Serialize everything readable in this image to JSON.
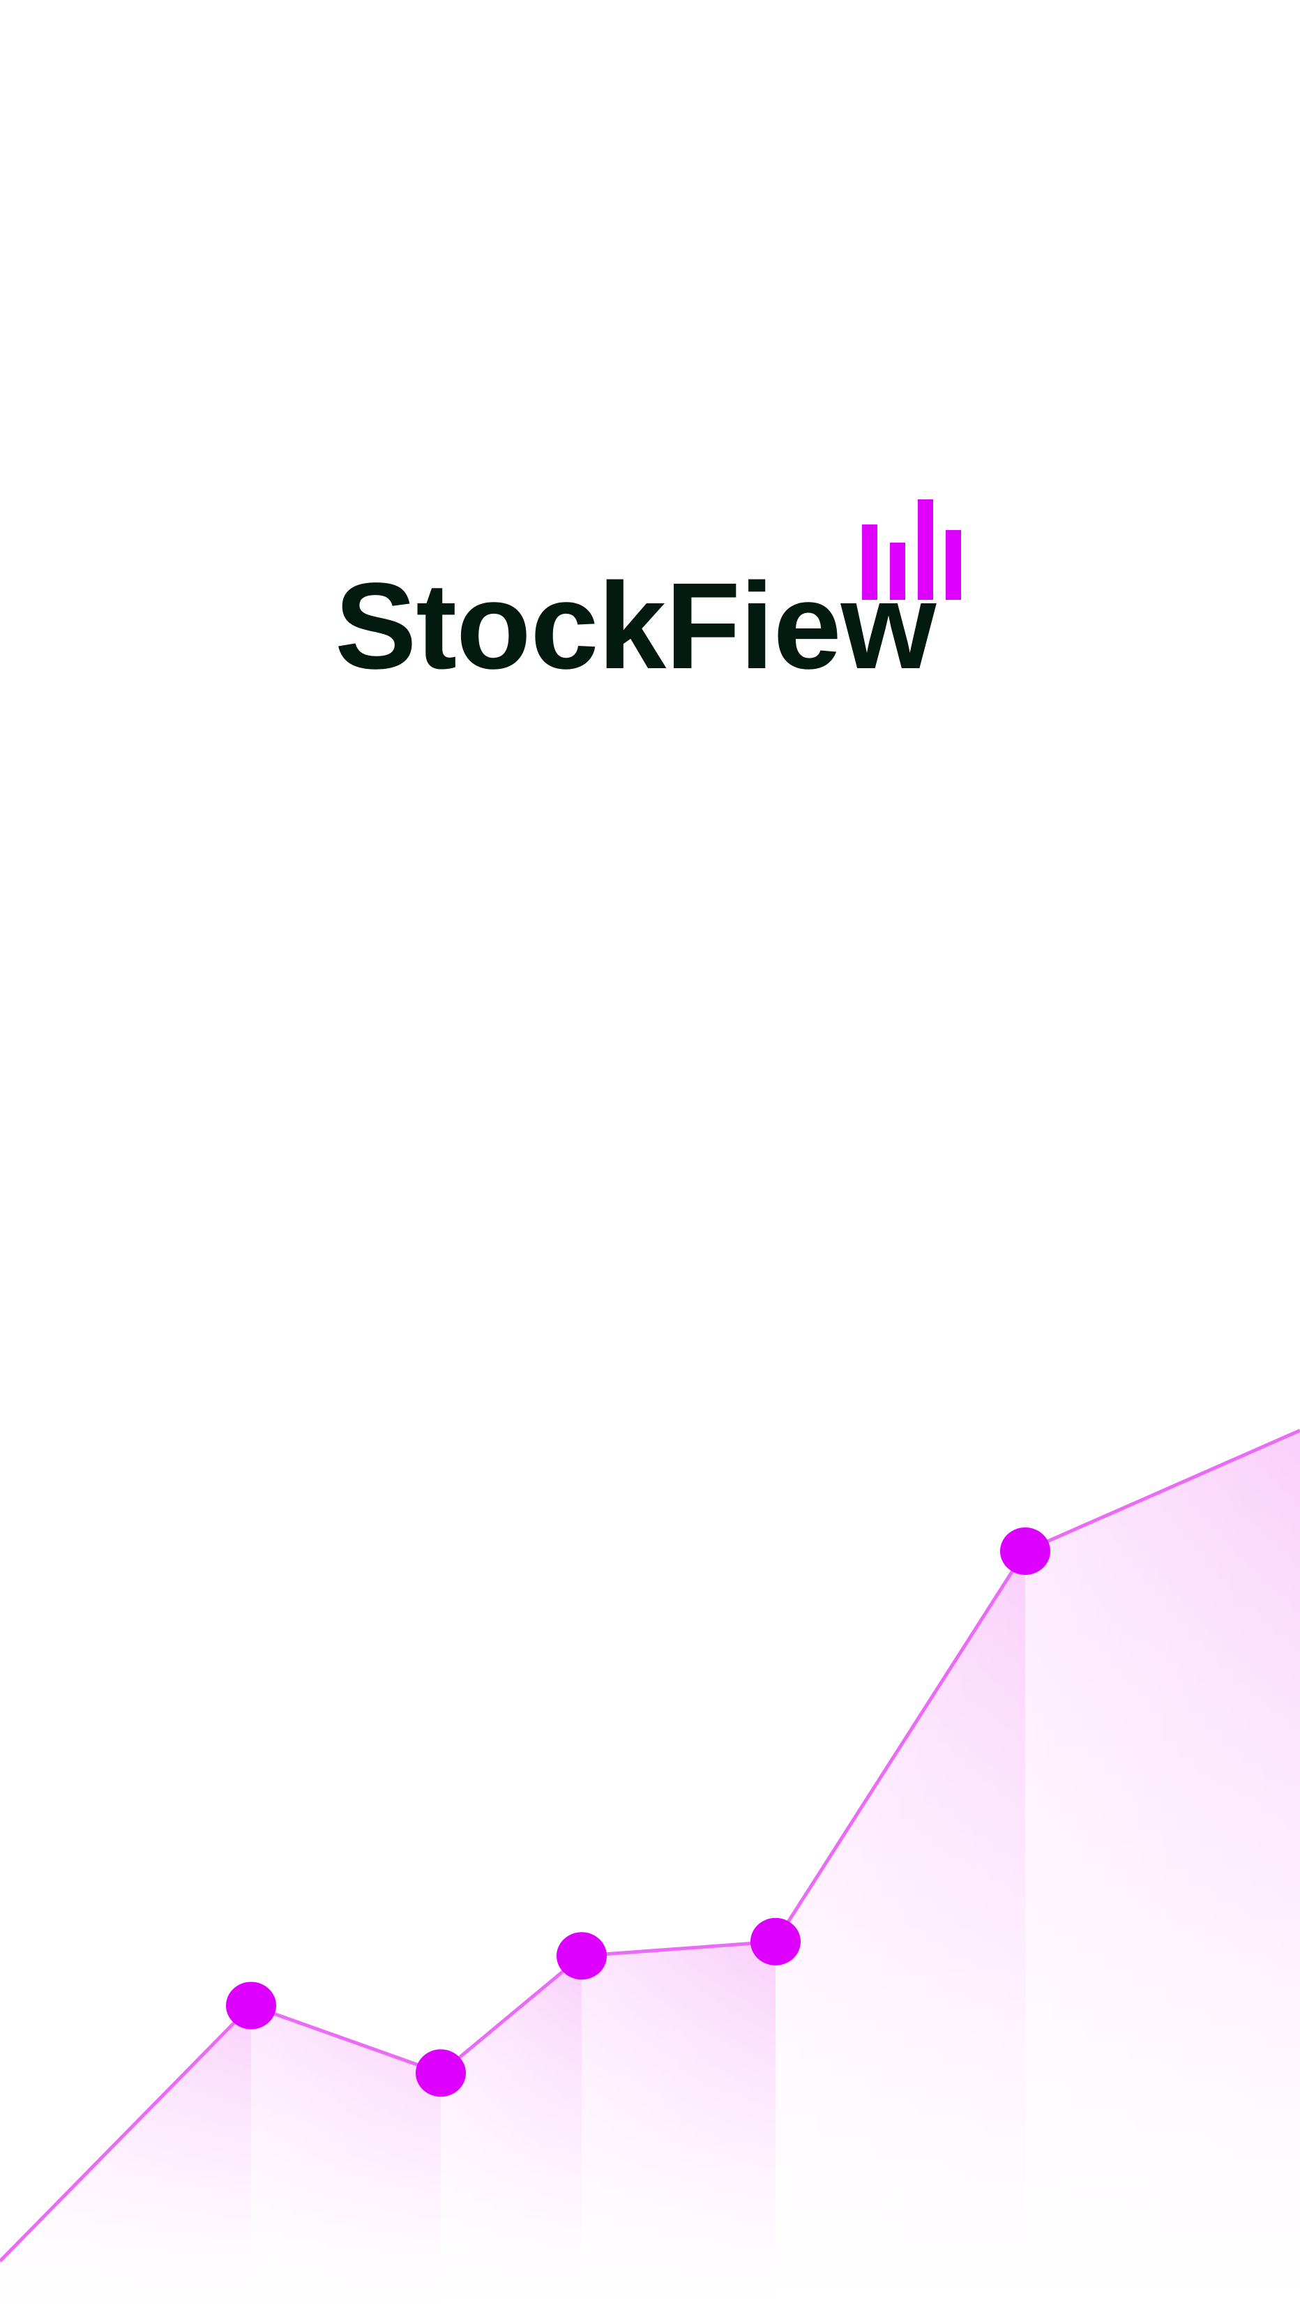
{
  "app": {
    "name": "StockFiew"
  },
  "colors": {
    "brand_text": "#021a0f",
    "accent": "#dd00ff",
    "line": "#ea6cf6",
    "background": "#ffffff"
  },
  "icons": {
    "logo_mark": "bar-chart-icon"
  },
  "chart_data": {
    "type": "area",
    "title": "",
    "xlabel": "",
    "ylabel": "",
    "x": [
      0,
      1,
      2,
      3,
      4,
      5,
      6,
      7
    ],
    "y": [
      0,
      36,
      26.5,
      43,
      45,
      100,
      117
    ],
    "grid": false,
    "markers": [
      false,
      true,
      true,
      true,
      true,
      true,
      false
    ]
  }
}
